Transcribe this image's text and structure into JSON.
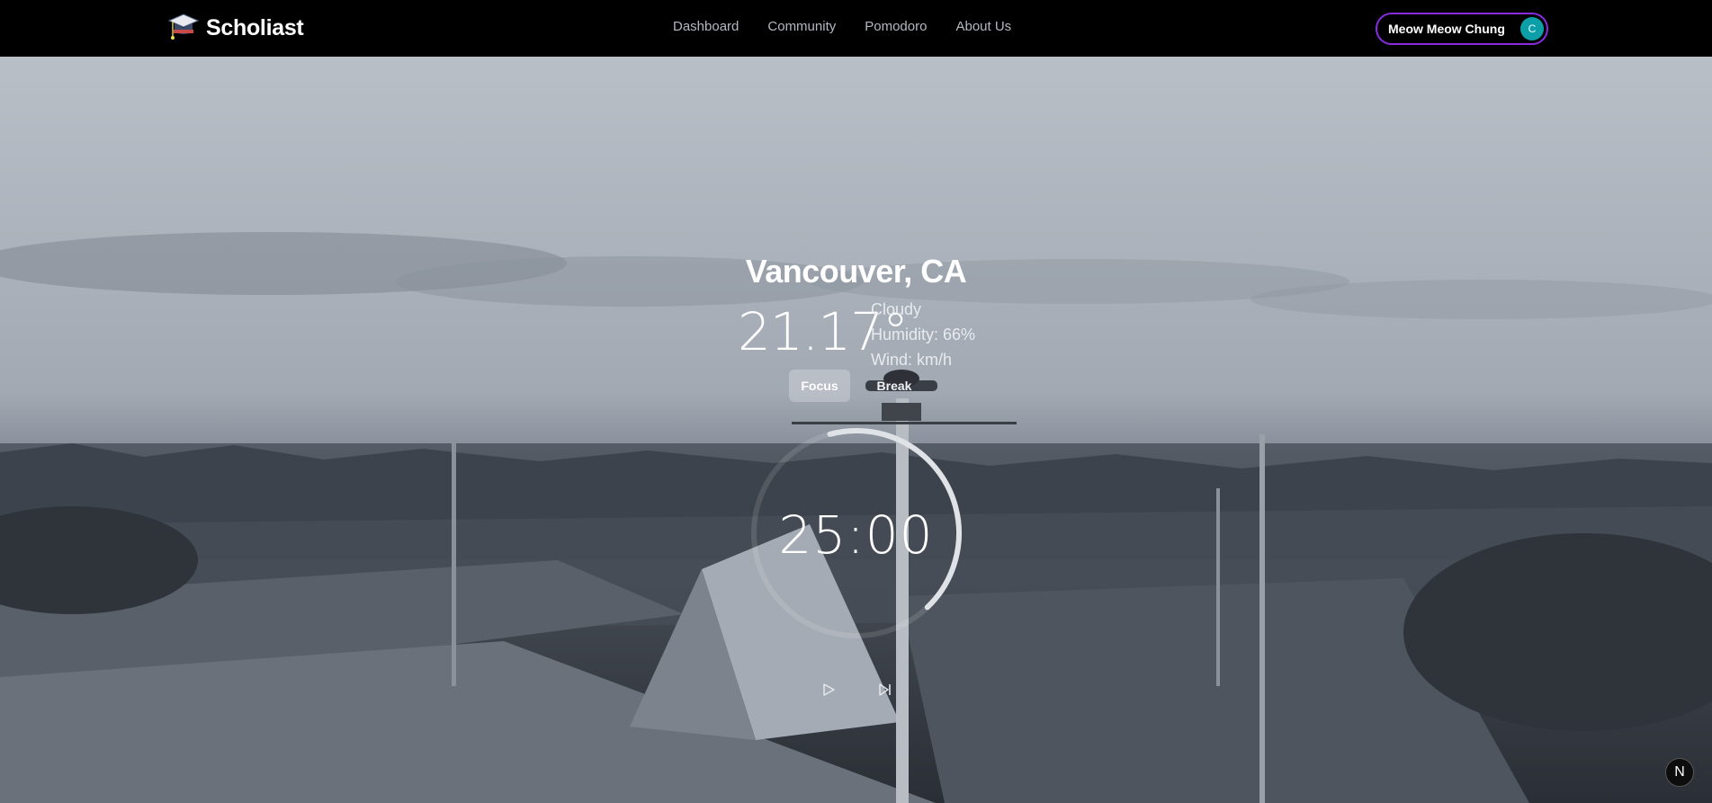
{
  "navbar": {
    "brand": "Scholiast",
    "links": [
      "Dashboard",
      "Community",
      "Pomodoro",
      "About Us"
    ],
    "user_name": "Meow Meow Chung",
    "avatar_initial": "C"
  },
  "weather": {
    "city": "Vancouver, CA",
    "temperature": "21.17°",
    "condition": "Cloudy",
    "humidity": "Humidity: 66%",
    "wind": "Wind: km/h"
  },
  "timer": {
    "modes": [
      "Focus",
      "Break"
    ],
    "active_mode": "Focus",
    "time": "25:00",
    "progress": 0.42
  },
  "badge": {
    "label": "N"
  },
  "icons": {
    "logo": "graduation-cap-icon",
    "play": "play-icon",
    "skip": "skip-forward-icon"
  }
}
